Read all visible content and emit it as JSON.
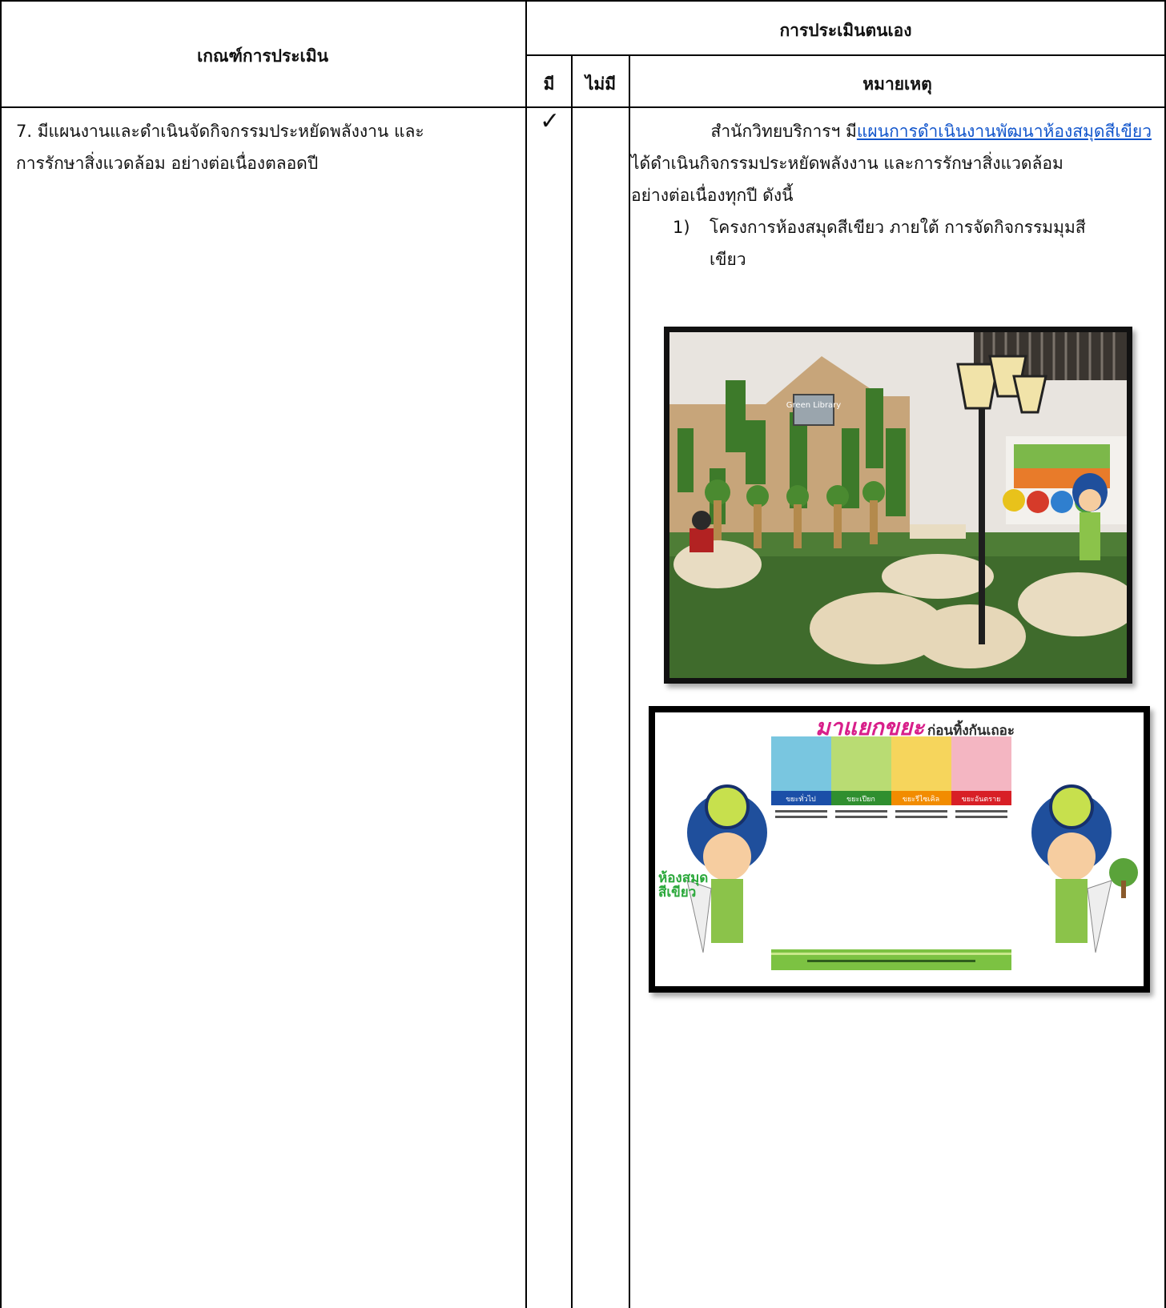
{
  "header": {
    "criteria_title": "เกณฑ์การประเมิน",
    "self_assessment_title": "การประเมินตนเอง",
    "col_have": "มี",
    "col_not_have": "ไม่มี",
    "col_remark": "หมายเหตุ"
  },
  "row": {
    "criteria_line1": "7. มีแผนงานและดำเนินจัดกิจกรรมประหยัดพลังงาน และ",
    "criteria_line2": "การรักษาสิ่งแวดล้อม อย่างต่อเนื่องตลอดปี",
    "check_mark": "✓",
    "remark_line1_prefix": "สำนักวิทยบริการฯ มี",
    "remark_link": "แผนการดำเนินงานพัฒนาห้องสมุดสีเขียว",
    "remark_line2": "ได้ดำเนินกิจกรรมประหยัดพลังงาน และการรักษาสิ่งแวดล้อม",
    "remark_line3": "อย่างต่อเนื่องทุกปี ดังนี้",
    "item_number": "1)",
    "item_line1": "โครงการห้องสมุดสีเขียว ภายใต้ การจัดกิจกรรมมุมสี",
    "item_line2": "เขียว"
  },
  "photo1": {
    "sign_text": "Green Library"
  },
  "poster": {
    "headline_big": "มาแยกขยะ",
    "headline_small": "ก่อนทิ้งกันเถอะ",
    "bins": [
      {
        "label": "ขยะทั่วไป",
        "color": "#1b4fa8"
      },
      {
        "label": "ขยะเปียก",
        "color": "#2f8f2f"
      },
      {
        "label": "ขยะรีไซเคิล",
        "color": "#f28c00"
      },
      {
        "label": "ขยะอันตราย",
        "color": "#d81f26"
      }
    ],
    "logo_text_line1": "ห้องสมุด",
    "logo_text_line2": "สีเขียว"
  }
}
